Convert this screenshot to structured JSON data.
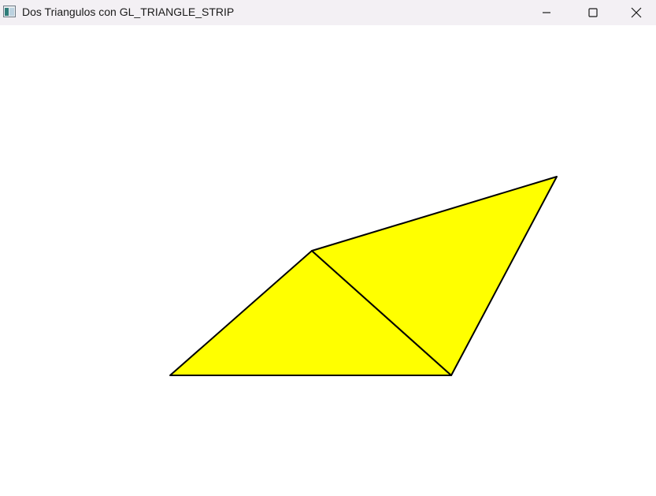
{
  "window": {
    "title": "Dos Triangulos con GL_TRIANGLE_STRIP",
    "app_icon": "opengl-window-icon",
    "controls": {
      "minimize_icon": "minimize-icon",
      "maximize_icon": "maximize-icon",
      "close_icon": "close-icon"
    }
  },
  "scene": {
    "background": "#ffffff",
    "fill_color": "#ffff00",
    "edge_color": "#000000",
    "primitive": "GL_TRIANGLE_STRIP",
    "triangle_count": 2
  }
}
